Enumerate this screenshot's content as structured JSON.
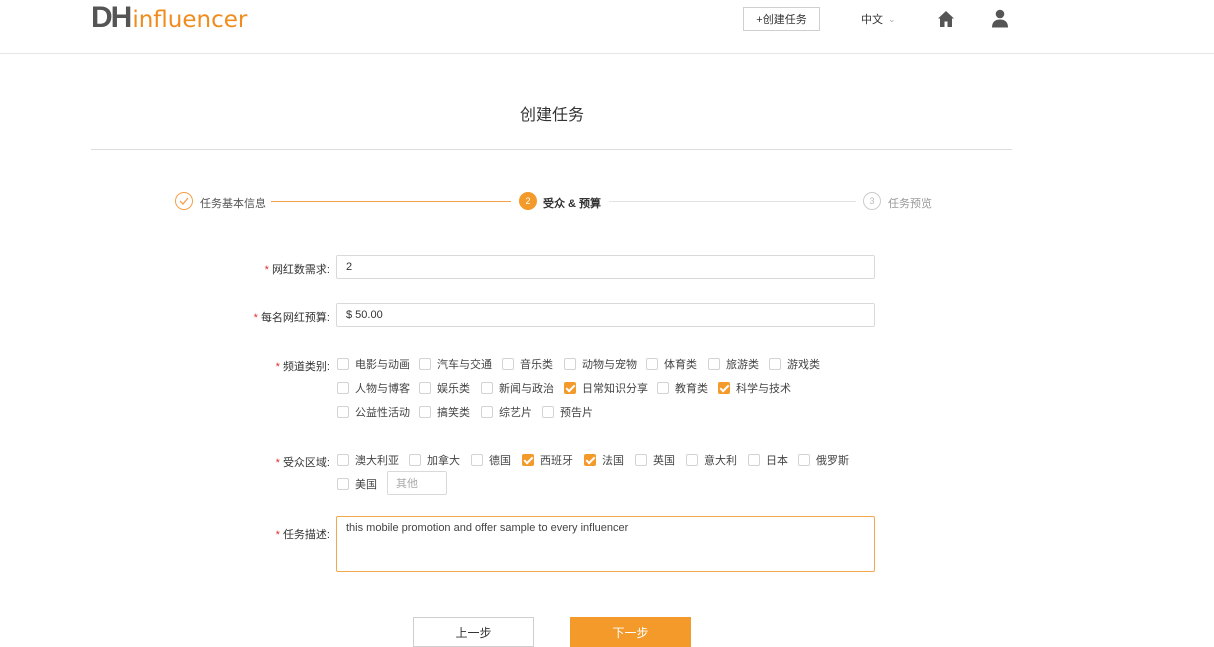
{
  "header": {
    "logo_dh": "DH",
    "logo_influencer": "influencer",
    "create_task": "+创建任务",
    "language": "中文",
    "icons": {
      "home": "home-icon",
      "user": "user-icon",
      "language_chevron": "chevron-down-icon"
    }
  },
  "page": {
    "title": "创建任务"
  },
  "steps": [
    {
      "index": "1",
      "label": "任务基本信息",
      "state": "done"
    },
    {
      "index": "2",
      "label": "受众 & 预算",
      "state": "active"
    },
    {
      "index": "3",
      "label": "任务预览",
      "state": "pending"
    }
  ],
  "form": {
    "required_mark": "*",
    "influencer_count": {
      "label": "网红数需求:",
      "value": "2"
    },
    "budget": {
      "label": "每名网红预算:",
      "value": "$ 50.00"
    },
    "channel": {
      "label": "频道类别:",
      "options": [
        {
          "label": "电影与动画",
          "checked": false
        },
        {
          "label": "汽车与交通",
          "checked": false
        },
        {
          "label": "音乐类",
          "checked": false
        },
        {
          "label": "动物与宠物",
          "checked": false
        },
        {
          "label": "体育类",
          "checked": false
        },
        {
          "label": "旅游类",
          "checked": false
        },
        {
          "label": "游戏类",
          "checked": false
        },
        {
          "label": "人物与博客",
          "checked": false
        },
        {
          "label": "娱乐类",
          "checked": false
        },
        {
          "label": "新闻与政治",
          "checked": false
        },
        {
          "label": "日常知识分享",
          "checked": true
        },
        {
          "label": "教育类",
          "checked": false
        },
        {
          "label": "科学与技术",
          "checked": true
        },
        {
          "label": "公益性活动",
          "checked": false
        },
        {
          "label": "搞笑类",
          "checked": false
        },
        {
          "label": "综艺片",
          "checked": false
        },
        {
          "label": "预告片",
          "checked": false
        }
      ]
    },
    "region": {
      "label": "受众区域:",
      "options": [
        {
          "label": "澳大利亚",
          "checked": false
        },
        {
          "label": "加拿大",
          "checked": false
        },
        {
          "label": "德国",
          "checked": false
        },
        {
          "label": "西班牙",
          "checked": true
        },
        {
          "label": "法国",
          "checked": true
        },
        {
          "label": "英国",
          "checked": false
        },
        {
          "label": "意大利",
          "checked": false
        },
        {
          "label": "日本",
          "checked": false
        },
        {
          "label": "俄罗斯",
          "checked": false
        },
        {
          "label": "美国",
          "checked": false
        }
      ],
      "other_placeholder": "其他"
    },
    "description": {
      "label": "任务描述:",
      "value": "this mobile promotion and offer sample to  every influencer"
    }
  },
  "buttons": {
    "prev": "上一步",
    "next": "下一步"
  },
  "colors": {
    "accent": "#f39a2a",
    "required": "#e0322c",
    "logo_gray": "#555555"
  }
}
